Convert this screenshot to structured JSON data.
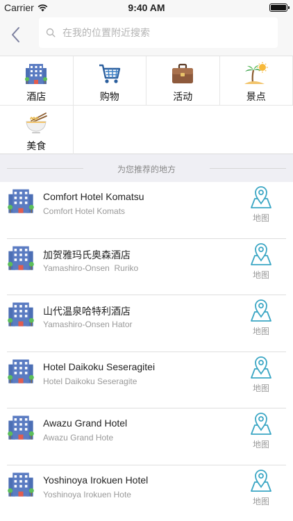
{
  "status_bar": {
    "carrier": "Carrier",
    "time": "9:40 AM"
  },
  "nav": {
    "search_placeholder": "在我的位置附近搜索"
  },
  "categories": [
    {
      "label": "酒店",
      "icon": "hotel-building-icon"
    },
    {
      "label": "购物",
      "icon": "shopping-cart-icon"
    },
    {
      "label": "活动",
      "icon": "briefcase-icon"
    },
    {
      "label": "景点",
      "icon": "island-palm-icon"
    },
    {
      "label": "美食",
      "icon": "noodle-bowl-icon"
    }
  ],
  "section_title": "为您推荐的地方",
  "places": [
    {
      "name": "Comfort Hotel Komatsu",
      "subtitle": "Comfort Hotel Komats",
      "map_label": "地图"
    },
    {
      "name": "加贺雅玛氏奥森酒店",
      "subtitle": "Yamashiro-Onsen  Ruriko",
      "map_label": "地图"
    },
    {
      "name": "山代温泉哈特利酒店",
      "subtitle": "Yamashiro-Onsen Hator",
      "map_label": "地图"
    },
    {
      "name": "Hotel Daikoku Seseragitei",
      "subtitle": "Hotel Daikoku Seseragite",
      "map_label": "地图"
    },
    {
      "name": "Awazu Grand Hotel",
      "subtitle": "Awazu Grand Hote",
      "map_label": "地图"
    },
    {
      "name": "Yoshinoya Irokuen Hotel",
      "subtitle": "Yoshinoya Irokuen Hote",
      "map_label": "地图"
    }
  ],
  "colors": {
    "accent": "#3aa6c4",
    "hotel_blue": "#4c6fb5",
    "background": "#efeff4"
  }
}
